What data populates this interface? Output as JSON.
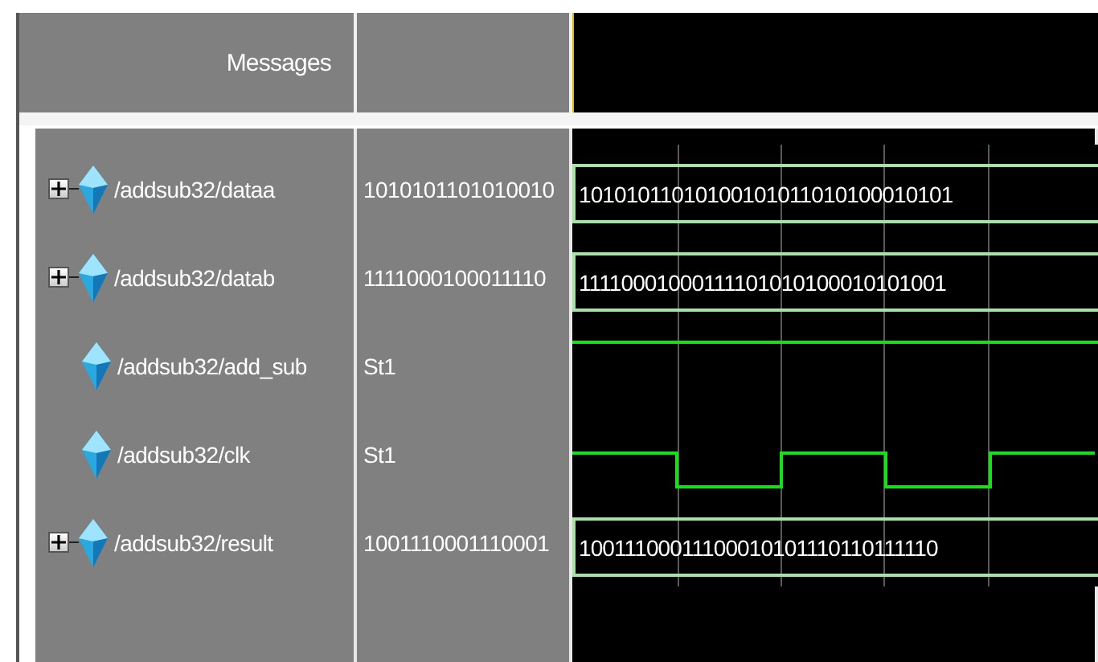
{
  "header": {
    "messages_label": "Messages"
  },
  "signals": [
    {
      "name": "/addsub32/dataa",
      "kind": "bus",
      "expandable": true,
      "value": "1010101101010010",
      "wave_value": "10101011010100101011010100010101"
    },
    {
      "name": "/addsub32/datab",
      "kind": "bus",
      "expandable": true,
      "value": "1111000100011110",
      "wave_value": "11110001000111101010100010101001"
    },
    {
      "name": "/addsub32/add_sub",
      "kind": "constant",
      "expandable": false,
      "value": "St1"
    },
    {
      "name": "/addsub32/clk",
      "kind": "clock",
      "expandable": false,
      "value": "St1"
    },
    {
      "name": "/addsub32/result",
      "kind": "bus",
      "expandable": true,
      "value": "1001110001110001",
      "wave_value": "10011100011100010101110110111110"
    }
  ]
}
